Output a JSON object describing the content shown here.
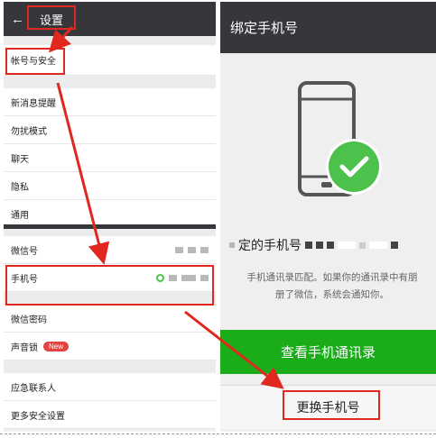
{
  "settings": {
    "title": "设置",
    "account_security": "帐号与安全",
    "items": [
      {
        "label": "新消息提醒"
      },
      {
        "label": "勿扰模式"
      },
      {
        "label": "聊天"
      },
      {
        "label": "隐私"
      },
      {
        "label": "通用"
      }
    ]
  },
  "security": {
    "wechat_id": "微信号",
    "phone": "手机号",
    "password": "微信密码",
    "voice_lock": "声音锁",
    "new_badge": "New",
    "emergency_contact": "应急联系人",
    "more_security": "更多安全设置"
  },
  "bind_phone": {
    "title": "绑定手机号",
    "bound_label": "定的手机号",
    "description_line1": "手机通讯录匹配。如果你的通讯录中有朋",
    "description_line2": "册了微信，系统会通知你。",
    "view_contacts": "查看手机通讯录",
    "change_phone": "更换手机号"
  },
  "colors": {
    "header_bg": "#37373b",
    "green": "#1aad19",
    "highlight": "#e0281f",
    "badge_red": "#e64340"
  },
  "icons": {
    "back": "back-arrow-icon",
    "phone": "phone-icon",
    "check": "check-icon"
  }
}
